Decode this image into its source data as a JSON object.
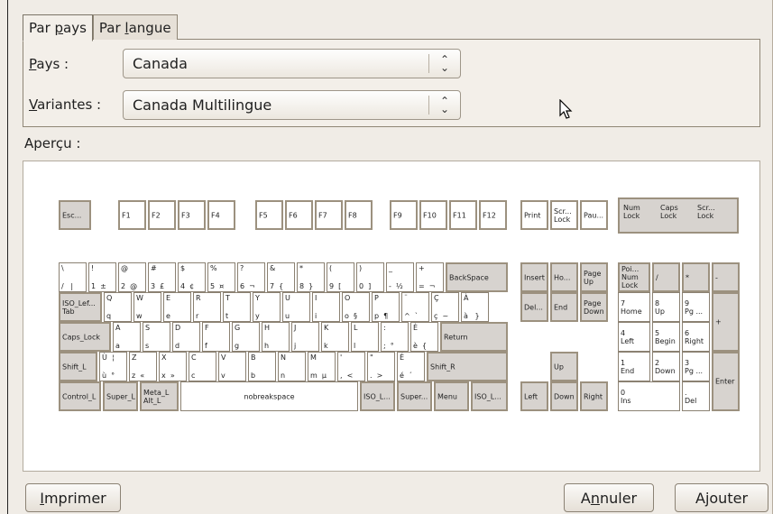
{
  "tabs": [
    {
      "label": "Par pays",
      "ul": "p",
      "pre": "Par ",
      "post": "ays"
    },
    {
      "label": "Par langue",
      "ul": "l",
      "pre": "Par ",
      "post": "angue"
    }
  ],
  "country": {
    "label_pre": "",
    "label_ul": "P",
    "label_post": "ays :",
    "value": "Canada"
  },
  "variant": {
    "label_pre": "",
    "label_ul": "V",
    "label_post": "ariantes :",
    "value": "Canada Multilingue"
  },
  "preview_label": "Aperçu :",
  "keyboard": {
    "esc": "Esc...",
    "f": [
      "F1",
      "F2",
      "F3",
      "F4",
      "F5",
      "F6",
      "F7",
      "F8",
      "F9",
      "F10",
      "F11",
      "F12"
    ],
    "print": "Print",
    "scroll": "Scr...\nLock",
    "pause": "Pau...",
    "num": "Num\nLock",
    "caps_ind": "Caps\nLock",
    "scr_ind": "Scr...\nLock",
    "row1": [
      {
        "t": "\\",
        "b": "/   |"
      },
      {
        "t": "!",
        "b": "1  ±"
      },
      {
        "t": "@",
        "b": "2  @"
      },
      {
        "t": "#",
        "b": "3  £"
      },
      {
        "t": "$",
        "b": "4  ¢"
      },
      {
        "t": "%",
        "b": "5  ¤"
      },
      {
        "t": "?",
        "b": "6  ¬"
      },
      {
        "t": "&",
        "b": "7  {"
      },
      {
        "t": "*",
        "b": "8  }"
      },
      {
        "t": "(",
        "b": "9  ["
      },
      {
        "t": ")",
        "b": "0  ]"
      },
      {
        "t": "_",
        "b": "-  ½"
      },
      {
        "t": "+",
        "b": "=  ¬"
      }
    ],
    "backspace": "BackSpace",
    "tab": "ISO_Lef...\nTab",
    "row2": [
      {
        "t": "Q",
        "b": "q"
      },
      {
        "t": "W",
        "b": "w"
      },
      {
        "t": "E",
        "b": "e"
      },
      {
        "t": "R",
        "b": "r"
      },
      {
        "t": "T",
        "b": "t"
      },
      {
        "t": "Y",
        "b": "y"
      },
      {
        "t": "U",
        "b": "u"
      },
      {
        "t": "I",
        "b": "i"
      },
      {
        "t": "O",
        "b": "o  §"
      },
      {
        "t": "P",
        "b": "p  ¶"
      },
      {
        "t": "¨",
        "b": "^  `"
      },
      {
        "t": "Ç",
        "b": "ç  ~"
      },
      {
        "t": "À",
        "b": "à   }"
      }
    ],
    "capslock": "Caps_Lock",
    "row3": [
      {
        "t": "A",
        "b": "a"
      },
      {
        "t": "S",
        "b": "s"
      },
      {
        "t": "D",
        "b": "d"
      },
      {
        "t": "F",
        "b": "f"
      },
      {
        "t": "G",
        "b": "g"
      },
      {
        "t": "H",
        "b": "h"
      },
      {
        "t": "J",
        "b": "j"
      },
      {
        "t": "K",
        "b": "k"
      },
      {
        "t": "L",
        "b": "l"
      },
      {
        "t": ":",
        "b": ";  °"
      },
      {
        "t": "È",
        "b": "è  {"
      }
    ],
    "return": "Return",
    "shift_l": "Shift_L",
    "row4": [
      {
        "t": "Ù  ¦",
        "b": "ù  °"
      },
      {
        "t": "Z",
        "b": "z  «"
      },
      {
        "t": "X",
        "b": "x  »"
      },
      {
        "t": "C",
        "b": "c"
      },
      {
        "t": "V",
        "b": "v"
      },
      {
        "t": "B",
        "b": "b"
      },
      {
        "t": "N",
        "b": "n"
      },
      {
        "t": "M",
        "b": "m  µ"
      },
      {
        "t": "'",
        "b": ",  <"
      },
      {
        "t": "\"",
        "b": ".  >"
      },
      {
        "t": "É",
        "b": "é  ´"
      }
    ],
    "shift_r": "Shift_R",
    "ctrl_l": "Control_L",
    "super_l": "Super_L",
    "alt_l": "Meta_L\nAlt_L",
    "space": "nobreakspace",
    "iso_l1": "ISO_L...",
    "super_r": "Super...",
    "menu": "Menu",
    "iso_l2": "ISO_L...",
    "insert": "Insert",
    "home": "Ho...",
    "pgup": "Page\nUp",
    "del": "Del...",
    "end": "End",
    "pgdn": "Page\nDown",
    "up": "Up",
    "left": "Left",
    "down": "Down",
    "right": "Right",
    "kp_num": "Poi...\nNum\nLock",
    "kp_div": "/",
    "kp_mul": "*",
    "kp_sub": "-",
    "kp7": "7\nHome",
    "kp8": "8\nUp",
    "kp9": "9\nPg ...",
    "kp_add": "+",
    "kp4": "4\nLeft",
    "kp5": "5\nBegin",
    "kp6": "6\nRight",
    "kp1": "1\nEnd",
    "kp2": "2\nDown",
    "kp3": "3\nPg ...",
    "kp_enter": "Enter",
    "kp0": "0\nIns",
    "kp_dot": ".\nDel"
  },
  "buttons": {
    "print": {
      "pre": "",
      "ul": "I",
      "post": "mprimer"
    },
    "cancel": {
      "pre": "A",
      "ul": "n",
      "post": "nuler"
    },
    "add": {
      "pre": "A",
      "ul": "j",
      "post": "outer"
    }
  }
}
